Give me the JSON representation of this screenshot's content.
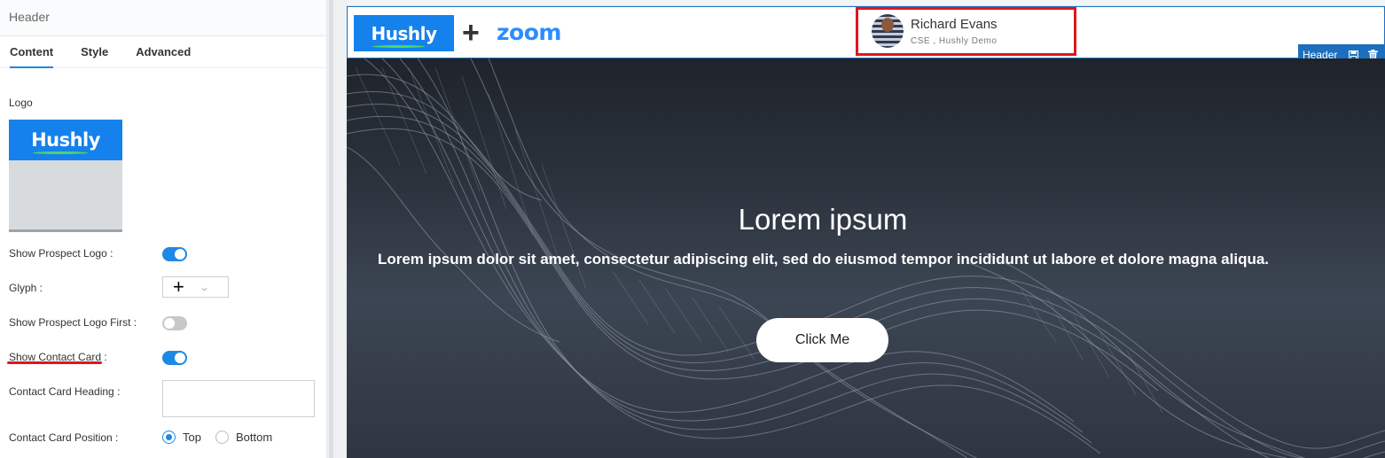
{
  "panel": {
    "title": "Header",
    "tabs": [
      {
        "label": "Content",
        "active": true
      },
      {
        "label": "Style",
        "active": false
      },
      {
        "label": "Advanced",
        "active": false
      }
    ],
    "logo_label": "Logo",
    "logo_text": "Hushly",
    "fields": {
      "show_prospect_logo": {
        "label": "Show Prospect Logo :",
        "enabled": true
      },
      "glyph": {
        "label": "Glyph :",
        "value": "+"
      },
      "show_prospect_logo_first": {
        "label": "Show Prospect Logo First :",
        "enabled": false
      },
      "show_contact_card": {
        "label": "Show Contact Card :",
        "enabled": true
      },
      "contact_card_heading": {
        "label": "Contact Card Heading :",
        "value": ""
      },
      "contact_card_position": {
        "label": "Contact Card Position :",
        "options": [
          "Top",
          "Bottom"
        ],
        "selected": "Top"
      }
    }
  },
  "preview": {
    "header": {
      "brand_left": "Hushly",
      "glyph": "+",
      "brand_right": "zoom",
      "contact": {
        "name": "Richard Evans",
        "subtitle": "CSE , Hushly Demo"
      },
      "tag": {
        "label": "Header",
        "icons": [
          "save-icon",
          "trash-icon"
        ]
      }
    },
    "hero": {
      "title": "Lorem ipsum",
      "text": "Lorem ipsum dolor sit amet, consectetur adipiscing elit, sed do eiusmod tempor incididunt ut labore et dolore magna aliqua.",
      "button": "Click Me"
    }
  },
  "colors": {
    "accent": "#1e88e5",
    "hushly_blue": "#1581ec",
    "zoom_blue": "#2d8cff",
    "highlight_red": "#e0161e",
    "tag_blue": "#1c6fbf"
  }
}
